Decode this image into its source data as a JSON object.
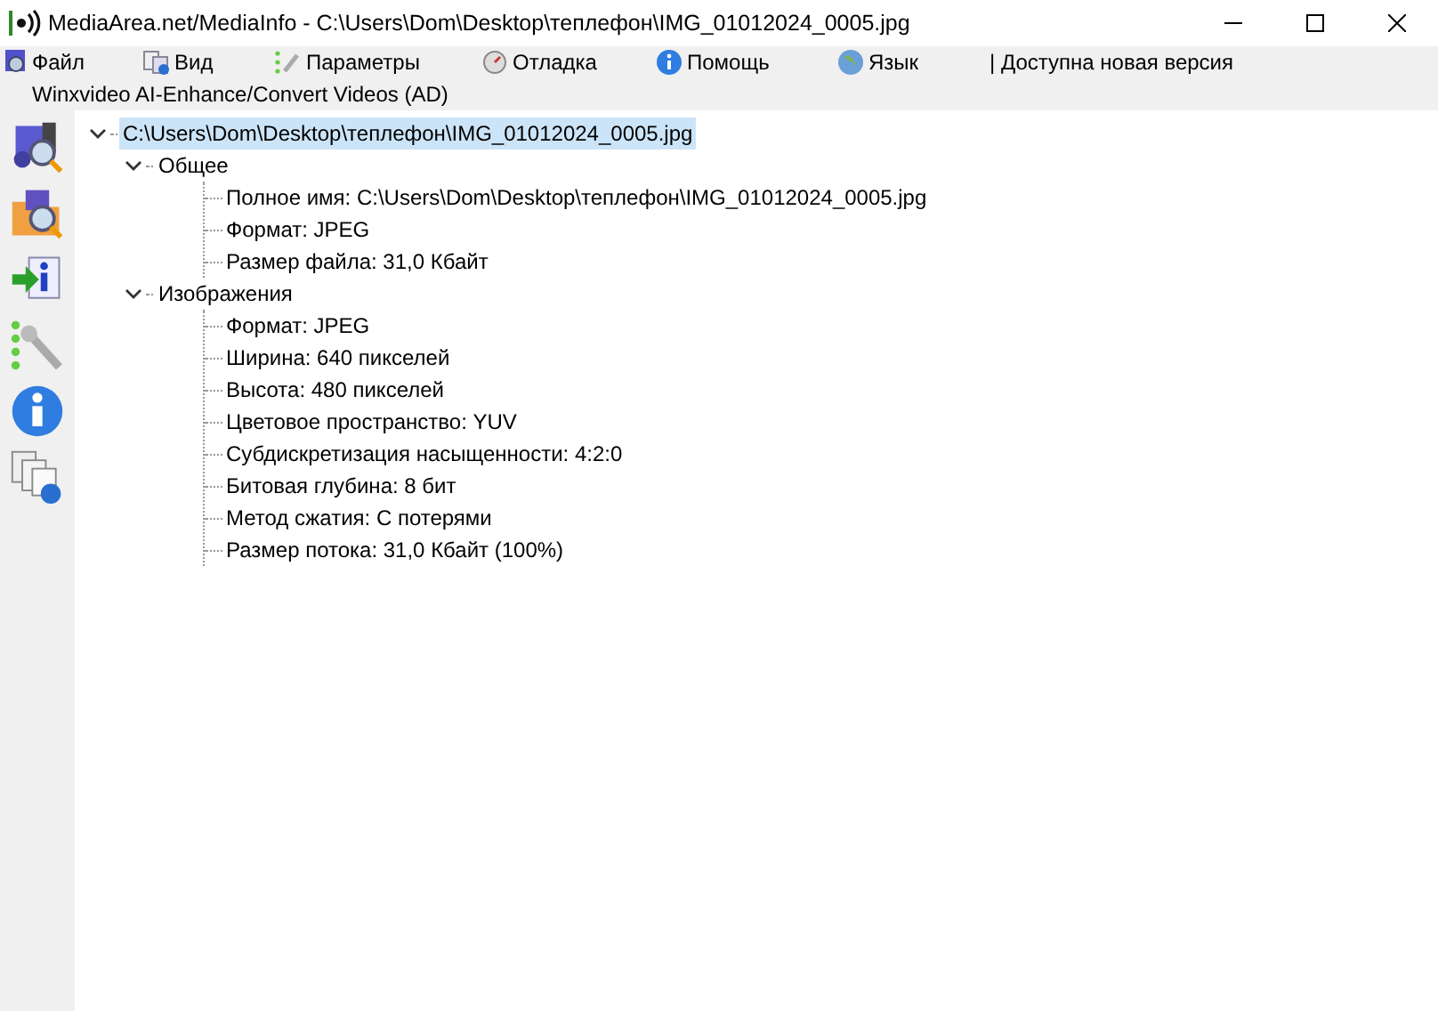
{
  "window": {
    "title": "MediaArea.net/MediaInfo - C:\\Users\\Dom\\Desktop\\теплефон\\IMG_01012024_0005.jpg"
  },
  "menu": [
    {
      "label": "Файл"
    },
    {
      "label": "Вид"
    },
    {
      "label": "Параметры"
    },
    {
      "label": "Отладка"
    },
    {
      "label": "Помощь"
    },
    {
      "label": "Язык"
    }
  ],
  "notice": "| Доступна новая версия",
  "ad": "Winxvideo AI-Enhance/Convert Videos (AD)",
  "tree": [
    {
      "label": "C:\\Users\\Dom\\Desktop\\теплефон\\IMG_01012024_0005.jpg",
      "selected": true,
      "expanded": true,
      "children": [
        {
          "label": "Общее",
          "selected": false,
          "expanded": true,
          "children": [
            {
              "label": "Полное имя: C:\\Users\\Dom\\Desktop\\теплефон\\IMG_01012024_0005.jpg",
              "selected": false
            },
            {
              "label": "Формат: JPEG",
              "selected": false
            },
            {
              "label": "Размер файла: 31,0 Кбайт",
              "selected": false
            }
          ]
        },
        {
          "label": "Изображения",
          "selected": false,
          "expanded": true,
          "children": [
            {
              "label": "Формат: JPEG",
              "selected": false
            },
            {
              "label": "Ширина: 640 пикселей",
              "selected": false
            },
            {
              "label": "Высота: 480 пикселей",
              "selected": false
            },
            {
              "label": "Цветовое пространство: YUV",
              "selected": false
            },
            {
              "label": "Субдискретизация насыщенности: 4:2:0",
              "selected": false
            },
            {
              "label": "Битовая глубина: 8 бит",
              "selected": false
            },
            {
              "label": "Метод сжатия: С потерями",
              "selected": false
            },
            {
              "label": "Размер потока: 31,0 Кбайт (100%)",
              "selected": false
            }
          ]
        }
      ]
    }
  ]
}
